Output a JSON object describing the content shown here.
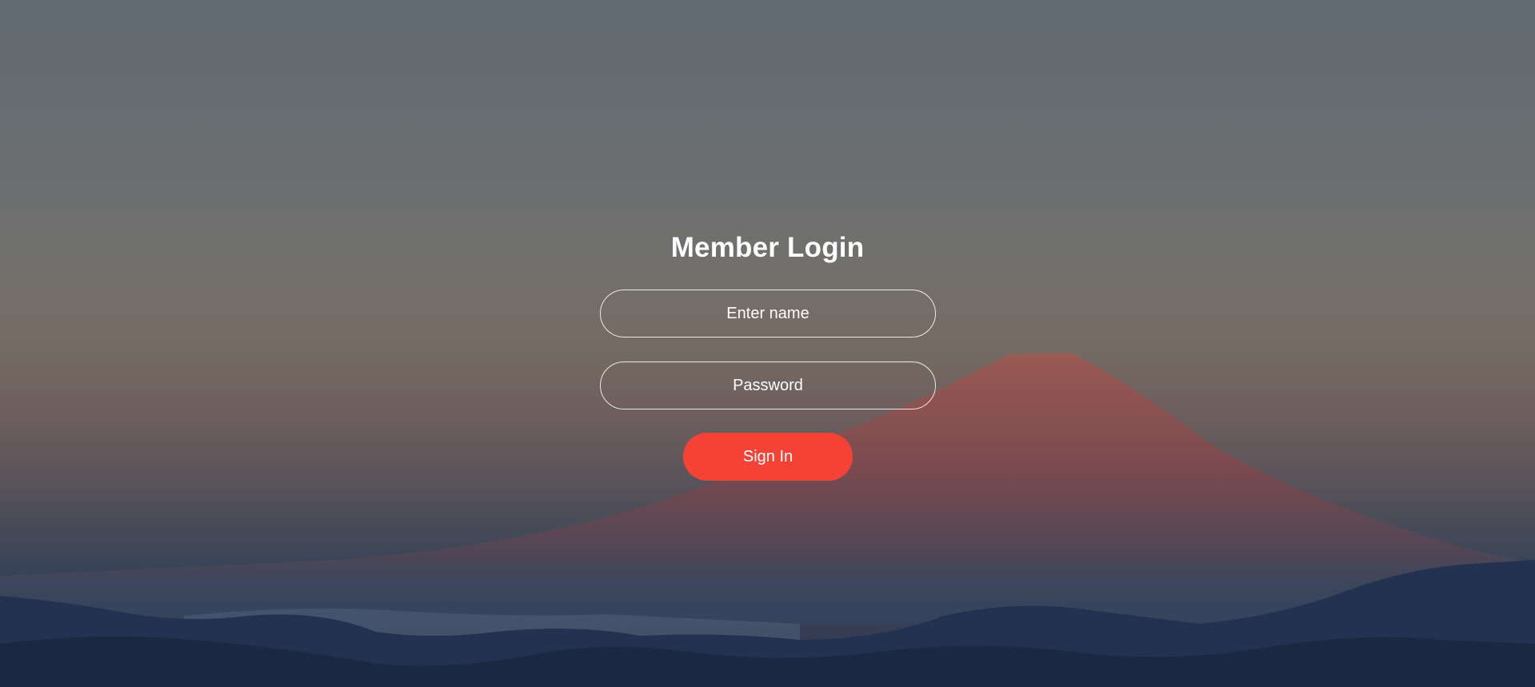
{
  "login": {
    "title": "Member Login",
    "name_placeholder": "Enter name",
    "password_placeholder": "Password",
    "sign_in_label": "Sign In"
  },
  "background": {
    "description": "mountain-landscape"
  },
  "colors": {
    "accent": "#f44336",
    "text": "#ffffff",
    "field_border": "#ffffff"
  }
}
